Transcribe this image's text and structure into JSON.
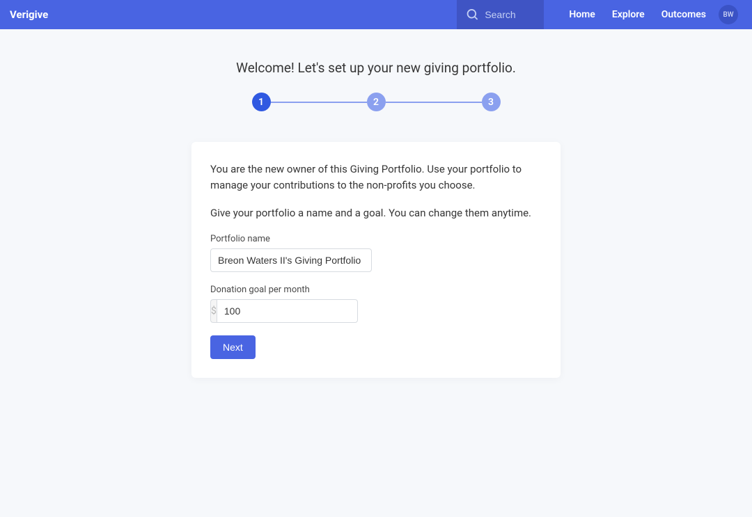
{
  "brand": "Verigive",
  "search": {
    "placeholder": "Search"
  },
  "nav": {
    "home": "Home",
    "explore": "Explore",
    "outcomes": "Outcomes"
  },
  "avatar_initials": "BW",
  "welcome_title": "Welcome! Let's set up your new giving portfolio.",
  "stepper": {
    "step1": "1",
    "step2": "2",
    "step3": "3",
    "current": 1
  },
  "card": {
    "intro1": "You are the new owner of this Giving Portfolio. Use your portfolio to manage your contributions to the non-profits you choose.",
    "intro2": "Give your portfolio a name and a goal. You can change them anytime.",
    "portfolio_name_label": "Portfolio name",
    "portfolio_name_value": "Breon Waters II's Giving Portfolio",
    "donation_goal_label": "Donation goal per month",
    "donation_goal_prefix": "$",
    "donation_goal_value": "100",
    "next_button": "Next"
  }
}
